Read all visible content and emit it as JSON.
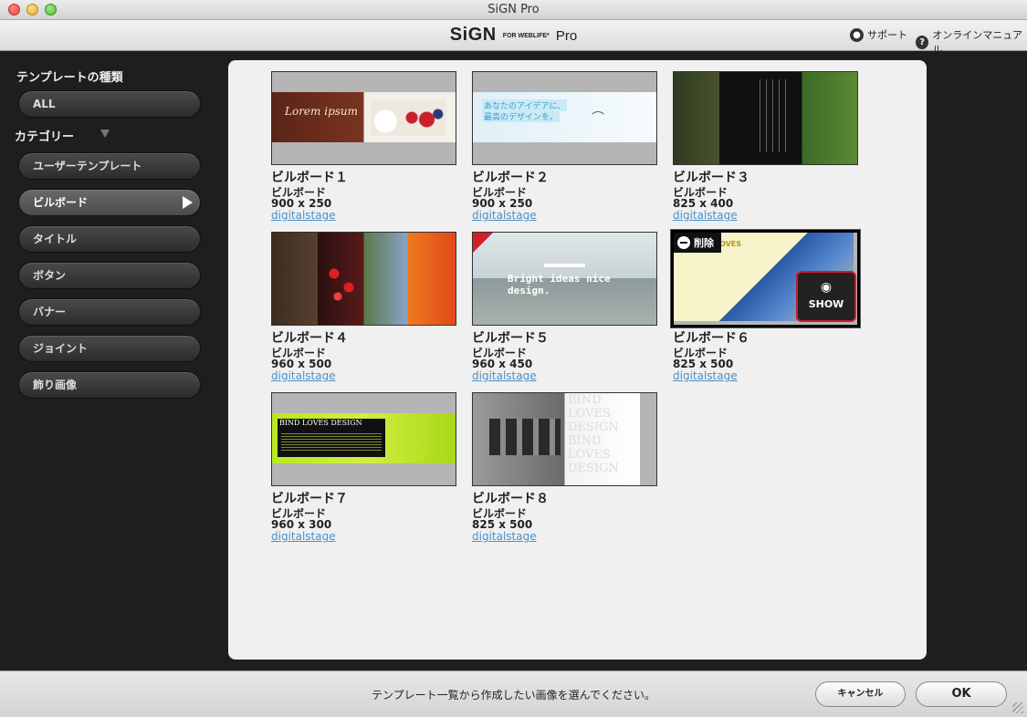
{
  "window": {
    "title": "SiGN Pro"
  },
  "header": {
    "logo_main": "SiGN",
    "logo_sub": "FOR WEBLIFE*",
    "logo_pro": "Pro",
    "support_label": "サポート",
    "manual_label": "オンラインマニュアル"
  },
  "sidebar": {
    "types_heading": "テンプレートの種類",
    "all_label": "ALL",
    "category_heading": "カテゴリー",
    "items": [
      {
        "label": "ユーザーテンプレート",
        "active": false
      },
      {
        "label": "ビルボード",
        "active": true
      },
      {
        "label": "タイトル",
        "active": false
      },
      {
        "label": "ボタン",
        "active": false
      },
      {
        "label": "バナー",
        "active": false
      },
      {
        "label": "ジョイント",
        "active": false
      },
      {
        "label": "飾り画像",
        "active": false
      }
    ]
  },
  "templates": [
    {
      "title": "ビルボード１",
      "category": "ビルボード",
      "size": "900 x 250",
      "author": "digitalstage",
      "thumb_text": "Lorem ipsum"
    },
    {
      "title": "ビルボード２",
      "category": "ビルボード",
      "size": "900 x 250",
      "author": "digitalstage",
      "thumb_text_1": "あなたのアイデアに、",
      "thumb_text_2": "最高のデザインを。"
    },
    {
      "title": "ビルボード３",
      "category": "ビルボード",
      "size": "825 x 400",
      "author": "digitalstage"
    },
    {
      "title": "ビルボード４",
      "category": "ビルボード",
      "size": "960 x 500",
      "author": "digitalstage"
    },
    {
      "title": "ビルボード５",
      "category": "ビルボード",
      "size": "960 x 450",
      "author": "digitalstage",
      "thumb_text": "Bright ideas nice design."
    },
    {
      "title": "ビルボード６",
      "category": "ビルボード",
      "size": "825 x 500",
      "author": "digitalstage",
      "thumb_text": "OVES",
      "delete_label": "削除",
      "show_label": "SHOW",
      "selected": true
    },
    {
      "title": "ビルボード７",
      "category": "ビルボード",
      "size": "960 x 300",
      "author": "digitalstage",
      "thumb_text": "BIND LOVES DESIGN"
    },
    {
      "title": "ビルボード８",
      "category": "ビルボード",
      "size": "825 x 500",
      "author": "digitalstage",
      "thumb_text": "BIND LOVES DESIGN BIND LOVES DESIGN"
    }
  ],
  "footer": {
    "message": "テンプレート一覧から作成したい画像を選んでください。",
    "cancel_label": "キャンセル",
    "ok_label": "OK"
  }
}
